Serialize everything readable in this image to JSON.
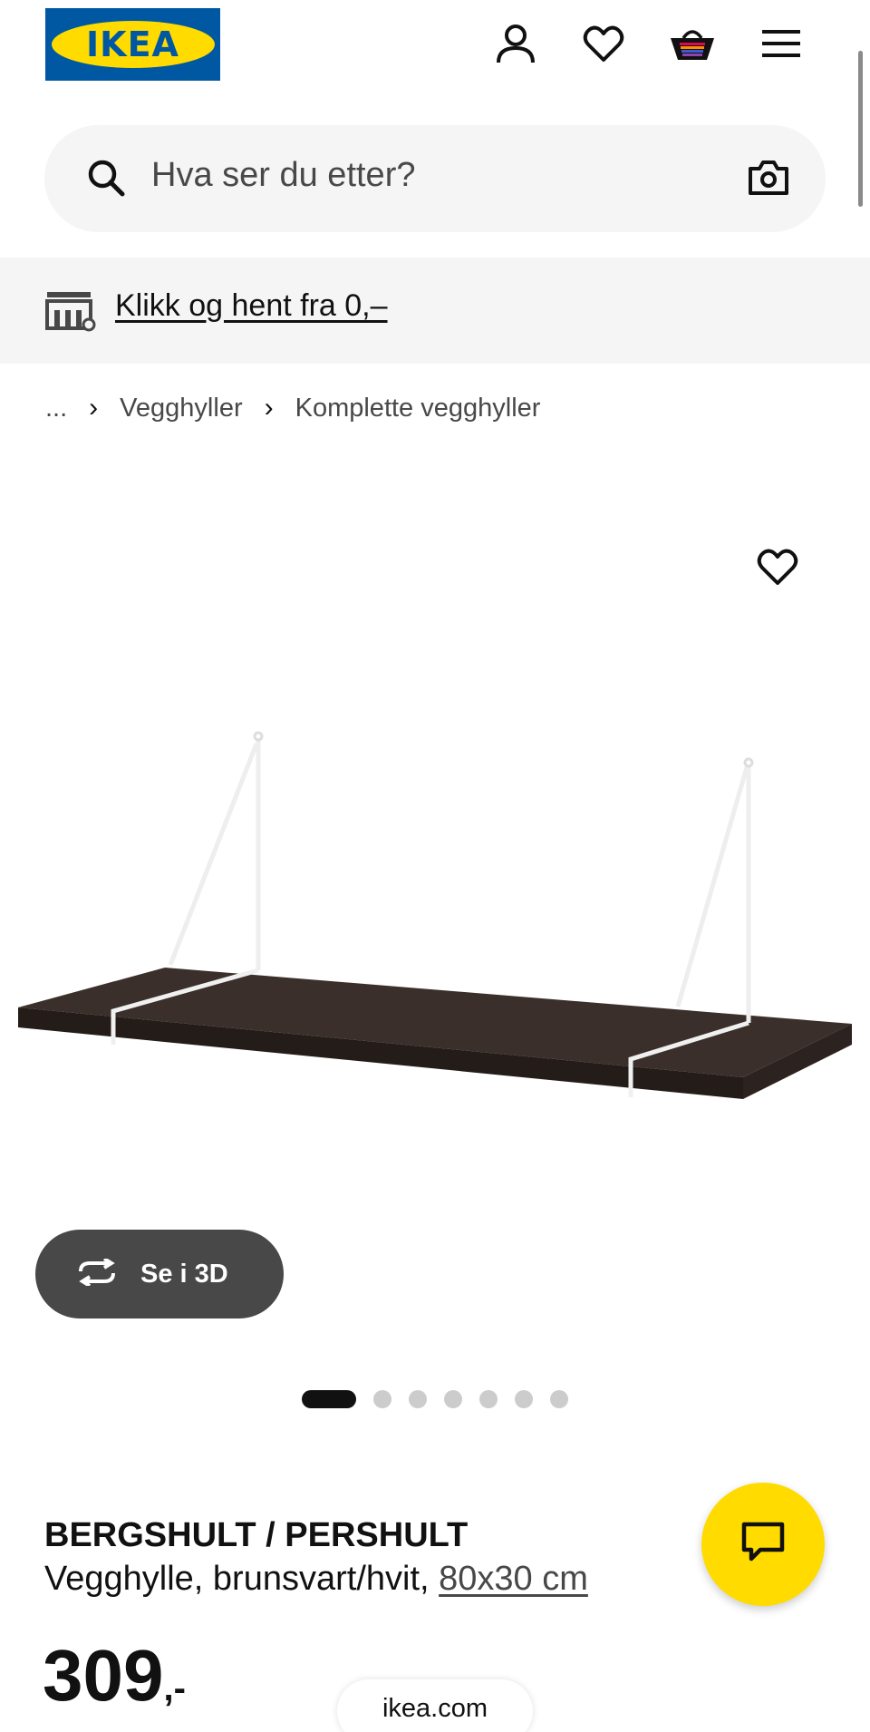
{
  "header": {
    "logo_text": "IKEA",
    "icons": [
      "profile-icon",
      "heart-icon",
      "basket-icon",
      "menu-icon"
    ]
  },
  "search": {
    "placeholder": "Hva ser du etter?",
    "icon": "search-icon",
    "camera_icon": "camera-icon"
  },
  "promo": {
    "icon": "store-icon",
    "text": "Klikk og hent fra 0,–"
  },
  "breadcrumb": {
    "ellipsis": "...",
    "items": [
      "Vegghyller",
      "Komplette vegghyller"
    ]
  },
  "gallery": {
    "view_3d_label": "Se i 3D",
    "dot_count": 7,
    "active_index": 0
  },
  "product": {
    "name": "BERGSHULT / PERSHULT",
    "description": "Vegghylle, brunsvart/hvit,",
    "size": "80x30 cm",
    "price": "309",
    "price_suffix": ",-"
  },
  "footer": {
    "domain": "ikea.com"
  },
  "colors": {
    "ikea_blue": "#0058a3",
    "ikea_yellow": "#ffdb00",
    "gray_bg": "#f5f5f5",
    "dark_button": "#484848"
  }
}
